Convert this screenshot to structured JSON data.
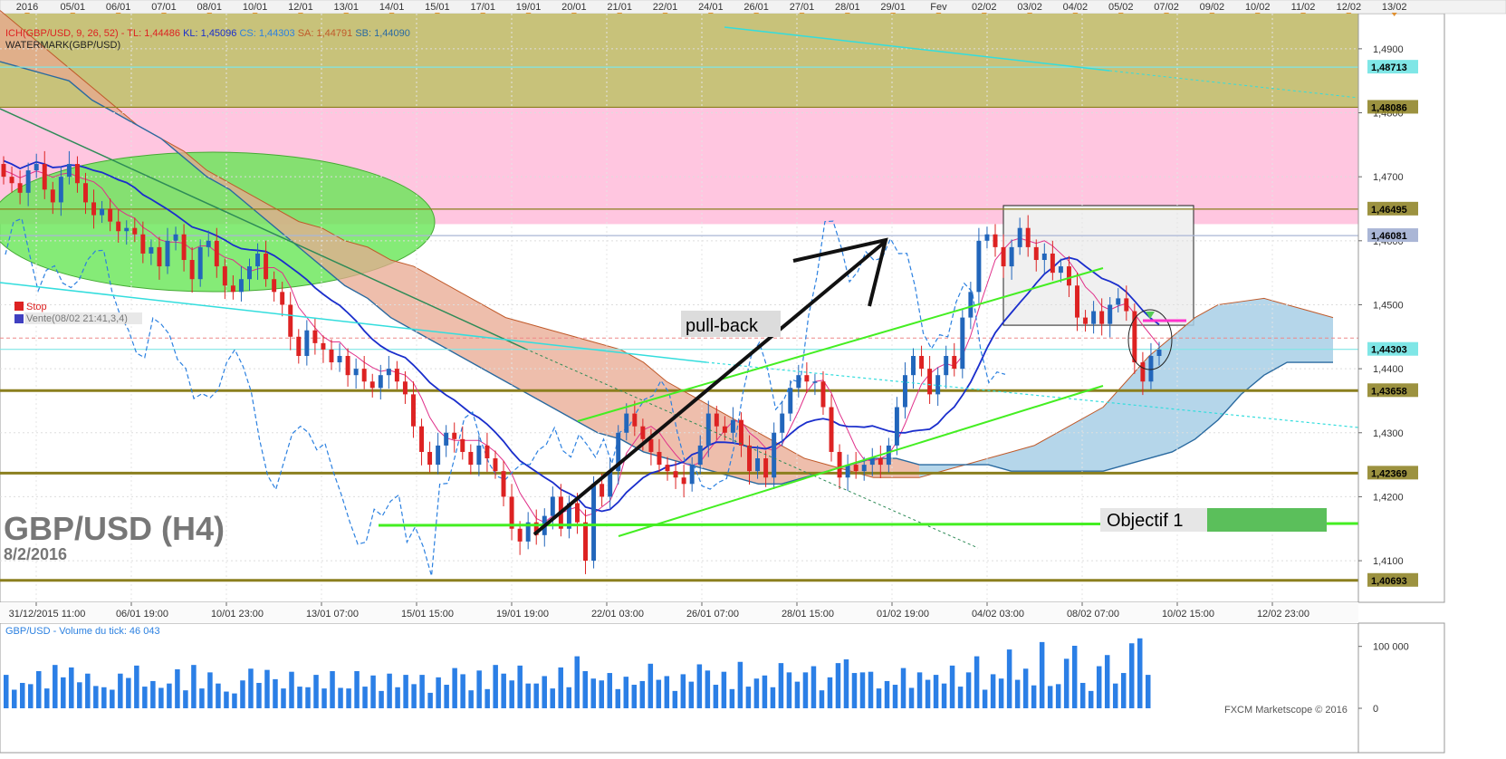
{
  "chart_data": {
    "type": "candlestick",
    "symbol_title": "GBP/USD (H4)",
    "date_label": "8/2/2016",
    "top_dates": [
      "2016",
      "05/01",
      "06/01",
      "07/01",
      "08/01",
      "10/01",
      "12/01",
      "13/01",
      "14/01",
      "15/01",
      "17/01",
      "19/01",
      "20/01",
      "21/01",
      "22/01",
      "24/01",
      "26/01",
      "27/01",
      "28/01",
      "29/01",
      "Fev",
      "02/02",
      "03/02",
      "04/02",
      "05/02",
      "07/02",
      "09/02",
      "10/02",
      "11/02",
      "12/02",
      "13/02"
    ],
    "bottom_dates": [
      "31/12/2015 11:00",
      "06/01 19:00",
      "10/01 23:00",
      "13/01 07:00",
      "15/01 15:00",
      "19/01 19:00",
      "22/01 03:00",
      "26/01 07:00",
      "28/01 15:00",
      "01/02 19:00",
      "04/02 03:00",
      "08/02 07:00",
      "10/02 15:00",
      "12/02 23:00"
    ],
    "y_ticks": [
      "1,4900",
      "1,4800",
      "1,4700",
      "1,4600",
      "1,4500",
      "1,4400",
      "1,4300",
      "1,4200",
      "1,4100"
    ],
    "y_range": [
      1.4035,
      1.4955
    ],
    "indicator_line": {
      "ich": "ICH(GBP/USD, 9, 26, 52)",
      "tl": "TL: 1,44486",
      "kl": "KL: 1,45096",
      "cs": "CS: 1,44303",
      "sa": "SA: 1,44791",
      "sb": "SB: 1,44090"
    },
    "watermark_label": "WATERMARK(GBP/USD)",
    "stop_label": "Stop",
    "order_label": "Vente(08/02 21:41,3,4)",
    "annotations": {
      "pullback": "pull-back",
      "target": "Objectif 1"
    },
    "levels": [
      {
        "label": "1,48713",
        "value": 1.48713,
        "color": "#7fe6e6"
      },
      {
        "label": "1,48086",
        "value": 1.48086,
        "color": "#8b7f1e"
      },
      {
        "label": "1,46495",
        "value": 1.46495,
        "color": "#8b7f1e"
      },
      {
        "label": "1,46081",
        "value": 1.46081,
        "color": "#aab6d6"
      },
      {
        "label": "1,44303",
        "value": 1.44303,
        "color": "#7fe6e6"
      },
      {
        "label": "1,43658",
        "value": 1.43658,
        "color": "#8b7f1e"
      },
      {
        "label": "1,42369",
        "value": 1.42369,
        "color": "#8b7f1e"
      },
      {
        "label": "1,40693",
        "value": 1.40693,
        "color": "#8b7f1e"
      }
    ],
    "close_series": [
      1.47,
      1.469,
      1.4675,
      1.471,
      1.472,
      1.468,
      1.466,
      1.47,
      1.472,
      1.469,
      1.466,
      1.464,
      1.465,
      1.463,
      1.4615,
      1.462,
      1.461,
      1.458,
      1.459,
      1.456,
      1.46,
      1.461,
      1.457,
      1.454,
      1.459,
      1.46,
      1.456,
      1.453,
      1.452,
      1.454,
      1.456,
      1.458,
      1.454,
      1.452,
      1.45,
      1.445,
      1.442,
      1.446,
      1.444,
      1.443,
      1.441,
      1.442,
      1.439,
      1.44,
      1.438,
      1.437,
      1.439,
      1.44,
      1.438,
      1.436,
      1.431,
      1.427,
      1.425,
      1.428,
      1.43,
      1.429,
      1.427,
      1.425,
      1.428,
      1.426,
      1.424,
      1.42,
      1.415,
      1.413,
      1.416,
      1.414,
      1.417,
      1.42,
      1.415,
      1.419,
      1.416,
      1.41,
      1.422,
      1.42,
      1.424,
      1.43,
      1.433,
      1.431,
      1.429,
      1.427,
      1.425,
      1.424,
      1.423,
      1.422,
      1.425,
      1.428,
      1.433,
      1.431,
      1.43,
      1.432,
      1.428,
      1.424,
      1.426,
      1.423,
      1.43,
      1.433,
      1.437,
      1.439,
      1.438,
      1.438,
      1.434,
      1.427,
      1.423,
      1.425,
      1.424,
      1.425,
      1.426,
      1.425,
      1.428,
      1.434,
      1.439,
      1.442,
      1.44,
      1.436,
      1.439,
      1.442,
      1.44,
      1.448,
      1.452,
      1.46,
      1.461,
      1.459,
      1.456,
      1.459,
      1.462,
      1.459,
      1.457,
      1.458,
      1.455,
      1.456,
      1.453,
      1.448,
      1.447,
      1.449,
      1.447,
      1.45,
      1.451,
      1.449,
      1.441,
      1.438,
      1.442,
      1.443
    ],
    "volume_label": "GBP/USD - Volume du tick: 46 043",
    "volume_ticks": [
      "100 000",
      "0"
    ],
    "volume_max": 120000,
    "volume": [
      54000,
      30000,
      41000,
      39000,
      60000,
      32000,
      70000,
      50000,
      66000,
      42000,
      56000,
      36000,
      34000,
      30000,
      56000,
      49000,
      69000,
      35000,
      44000,
      33000,
      40000,
      63000,
      29000,
      70000,
      32000,
      58000,
      40000,
      27000,
      24000,
      45000,
      64000,
      41000,
      62000,
      47000,
      32000,
      59000,
      35000,
      34000,
      54000,
      32000,
      60000,
      33000,
      32000,
      60000,
      35000,
      53000,
      28000,
      56000,
      34000,
      54000,
      39000,
      54000,
      25000,
      50000,
      38000,
      65000,
      55000,
      29000,
      61000,
      31000,
      70000,
      56000,
      45000,
      69000,
      40000,
      40000,
      52000,
      32000,
      66000,
      34000,
      84000,
      60000,
      48000,
      45000,
      57000,
      31000,
      51000,
      38000,
      44000,
      72000,
      46000,
      52000,
      28000,
      55000,
      43000,
      71000,
      61000,
      38000,
      59000,
      31000,
      75000,
      35000,
      48000,
      53000,
      34000,
      73000,
      58000,
      43000,
      58000,
      68000,
      29000,
      50000,
      73000,
      79000,
      57000,
      58000,
      59000,
      32000,
      44000,
      38000,
      65000,
      33000,
      58000,
      46000,
      54000,
      40000,
      69000,
      35000,
      58000,
      84000,
      30000,
      55000,
      48000,
      95000,
      46000,
      64000,
      37000,
      107000,
      36000,
      39000,
      80000,
      101000,
      41000,
      28000,
      68000,
      86000,
      40000,
      57000,
      105000,
      113000,
      54000
    ],
    "footer": "FXCM Marketscope © 2016",
    "colors": {
      "bull": "#2266bb",
      "bear": "#dd2222",
      "tenkan": "#e0308a",
      "kijun": "#1a2ecc",
      "chikou": "#2b80e0",
      "ssa": "#c05a2a",
      "ssb": "#2a6aa0",
      "kumo_bear": "#e8a890",
      "kumo_bull": "#a8cfe6",
      "zone_olive": "#c8c27a",
      "zone_pink": "#ffc6e0",
      "ellipse": "#66e655",
      "trend_green": "#44ee22",
      "cyan": "#33dddd"
    }
  }
}
